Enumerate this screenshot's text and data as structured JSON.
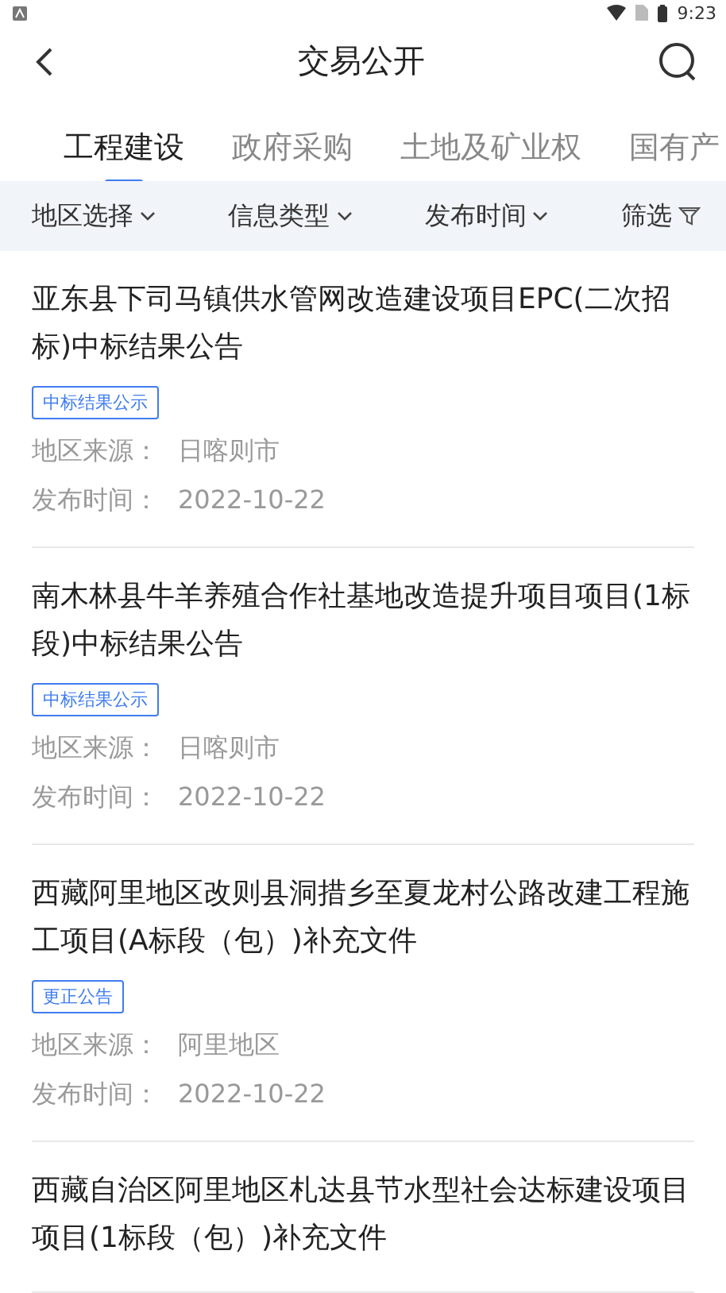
{
  "status_bar": {
    "time": "9:23"
  },
  "header": {
    "title": "交易公开"
  },
  "tabs": [
    {
      "label": "工程建设",
      "selected": true
    },
    {
      "label": "政府采购",
      "selected": false
    },
    {
      "label": "土地及矿业权",
      "selected": false
    },
    {
      "label": "国有产",
      "selected": false
    }
  ],
  "filters": [
    {
      "label": "地区选择",
      "kind": "dropdown"
    },
    {
      "label": "信息类型",
      "kind": "dropdown"
    },
    {
      "label": "发布时间",
      "kind": "dropdown"
    },
    {
      "label": "筛选",
      "kind": "filter"
    }
  ],
  "items": [
    {
      "title": "亚东县下司马镇供水管网改造建设项目EPC(二次招标)中标结果公告",
      "tag": "中标结果公示",
      "source_label": "地区来源：",
      "source": "日喀则市",
      "date_label": "发布时间：",
      "date": "2022-10-22"
    },
    {
      "title": "南木林县牛羊养殖合作社基地改造提升项目项目(1标段)中标结果公告",
      "tag": "中标结果公示",
      "source_label": "地区来源：",
      "source": "日喀则市",
      "date_label": "发布时间：",
      "date": "2022-10-22"
    },
    {
      "title": "西藏阿里地区改则县洞措乡至夏龙村公路改建工程施工项目(A标段（包）)补充文件",
      "tag": "更正公告",
      "source_label": "地区来源：",
      "source": "阿里地区",
      "date_label": "发布时间：",
      "date": "2022-10-22"
    },
    {
      "title": "西藏自治区阿里地区札达县节水型社会达标建设项目项目(1标段（包）)补充文件"
    }
  ]
}
